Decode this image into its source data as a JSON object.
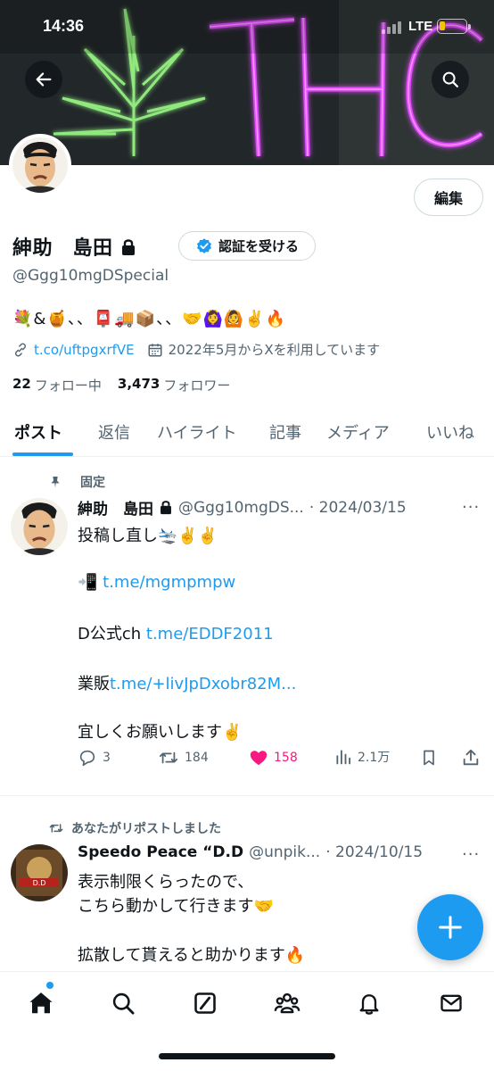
{
  "status_bar": {
    "time": "14:36",
    "network": "LTE"
  },
  "profile": {
    "display_name": "紳助　島田",
    "handle": "@Ggg10mgDSpecial",
    "verify_button": "認証を受ける",
    "edit_button": "編集",
    "bio": "💐&🍯、、📮🚚📦、、🤝🙆‍♀️🙆✌️🔥",
    "link": "t.co/uftpgxrfVE",
    "joined": "2022年5月からXを利用しています",
    "following_count": "22",
    "following_label": "フォロー中",
    "followers_count": "3,473",
    "followers_label": "フォロワー",
    "banner_text": "THC"
  },
  "tabs": [
    "ポスト",
    "返信",
    "ハイライト",
    "記事",
    "メディア",
    "いいね"
  ],
  "pinned_tweet": {
    "context": "固定",
    "author_name": "紳助　島田",
    "author_handle": "@Ggg10mgDS...",
    "date": "· 2024/03/15",
    "line1": "投稿し直し🛬✌️✌️",
    "line2_icon": "📲",
    "line2_link": "t.me/mgmpmpw",
    "line3_prefix": "D公式ch ",
    "line3_link": "t.me/EDDF2011",
    "line4_prefix": "業販",
    "line4_link": "t.me/+livJpDxobr82M...",
    "line5": "宜しくお願いします✌️",
    "replies": "3",
    "reposts": "184",
    "likes": "158",
    "views": "2.1万"
  },
  "repost_tweet": {
    "context": "あなたがリポストしました",
    "author_name": "Speedo Peace “D.D",
    "author_handle": "@unpik...",
    "date": "· 2024/10/15",
    "line1": "表示制限くらったので、",
    "line2": "こちら動かして行きます🤝",
    "line3": "拡散して貰えると助かります🔥"
  },
  "icons": {
    "back": "arrow-left-icon",
    "search": "search-icon",
    "lock": "lock-icon",
    "verified": "verified-badge-icon",
    "compose": "plus-icon"
  },
  "colors": {
    "accent": "#1d9bf0",
    "like": "#f91880",
    "text": "#0f1419",
    "muted": "#536471",
    "neon_pink": "#d63cff",
    "neon_green": "#8cff7a"
  }
}
